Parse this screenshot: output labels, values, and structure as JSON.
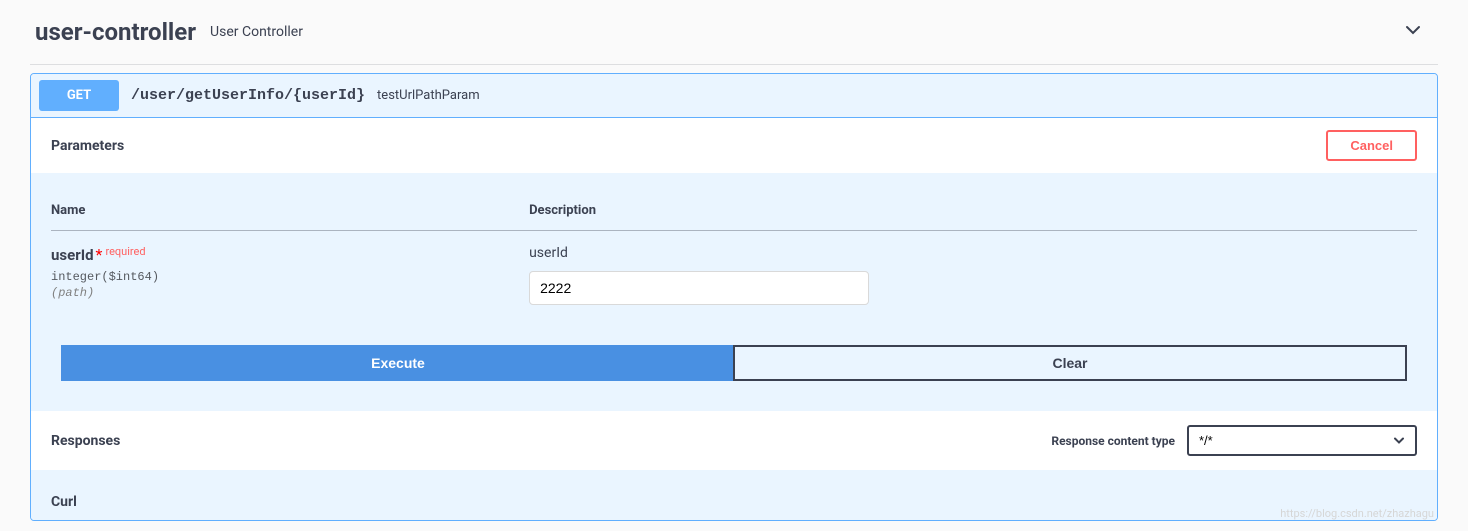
{
  "tag": {
    "name": "user-controller",
    "description": "User Controller"
  },
  "operation": {
    "method": "GET",
    "path": "/user/getUserInfo/{userId}",
    "summary": "testUrlPathParam"
  },
  "parameters_section": {
    "title": "Parameters",
    "cancel_label": "Cancel",
    "columns": {
      "name": "Name",
      "description": "Description"
    },
    "params": [
      {
        "name": "userId",
        "required_label": "required",
        "type": "integer($int64)",
        "in": "(path)",
        "description": "userId",
        "value": "2222"
      }
    ],
    "execute_label": "Execute",
    "clear_label": "Clear"
  },
  "responses_section": {
    "title": "Responses",
    "content_type_label": "Response content type",
    "content_type_value": "*/*"
  },
  "curl_section": {
    "title": "Curl"
  },
  "watermark": "https://blog.csdn.net/zhazhagu"
}
